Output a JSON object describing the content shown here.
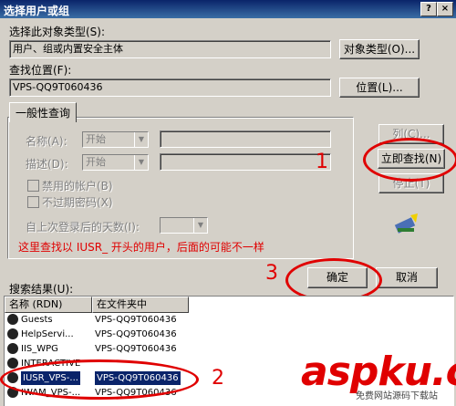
{
  "window": {
    "title": "选择用户或组",
    "help_button": "?",
    "close_button": "×"
  },
  "object_type": {
    "label": "选择此对象类型(S):",
    "value": "用户、组或内置安全主体",
    "button": "对象类型(O)..."
  },
  "location": {
    "label": "查找位置(F):",
    "value": "VPS-QQ9T060436",
    "button": "位置(L)..."
  },
  "query_tab": {
    "label": "一般性查询"
  },
  "query": {
    "name_label": "名称(A):",
    "name_mode": "开始",
    "desc_label": "描述(D):",
    "desc_mode": "开始",
    "disabled_accounts": "禁用的帐户(B)",
    "non_expiring": "不过期密码(X)",
    "days_label": "自上次登录后的天数(I):"
  },
  "side_buttons": {
    "columns": "列(C)...",
    "find_now": "立即查找(N)",
    "stop": "停止(T)"
  },
  "annotation": {
    "note": "这里查找以 IUSR_ 开头的用户，后面的可能不一样",
    "num1": "1",
    "num2": "2",
    "num3": "3"
  },
  "actions": {
    "ok": "确定",
    "cancel": "取消"
  },
  "results": {
    "label": "搜索结果(U):",
    "columns": [
      "名称 (RDN)",
      "在文件夹中"
    ],
    "rows": [
      {
        "name": "Guests",
        "folder": "VPS-QQ9T060436"
      },
      {
        "name": "HelpServi...",
        "folder": "VPS-QQ9T060436"
      },
      {
        "name": "IIS_WPG",
        "folder": "VPS-QQ9T060436"
      },
      {
        "name": "INTERACTIVE",
        "folder": ""
      },
      {
        "name": "IUSR_VPS-...",
        "folder": "VPS-QQ9T060436"
      },
      {
        "name": "IWAM_VPS-...",
        "folder": "VPS-QQ9T060436"
      }
    ]
  },
  "watermark": {
    "brand": "aspku.com",
    "sub": "免费网站源码下载站"
  }
}
